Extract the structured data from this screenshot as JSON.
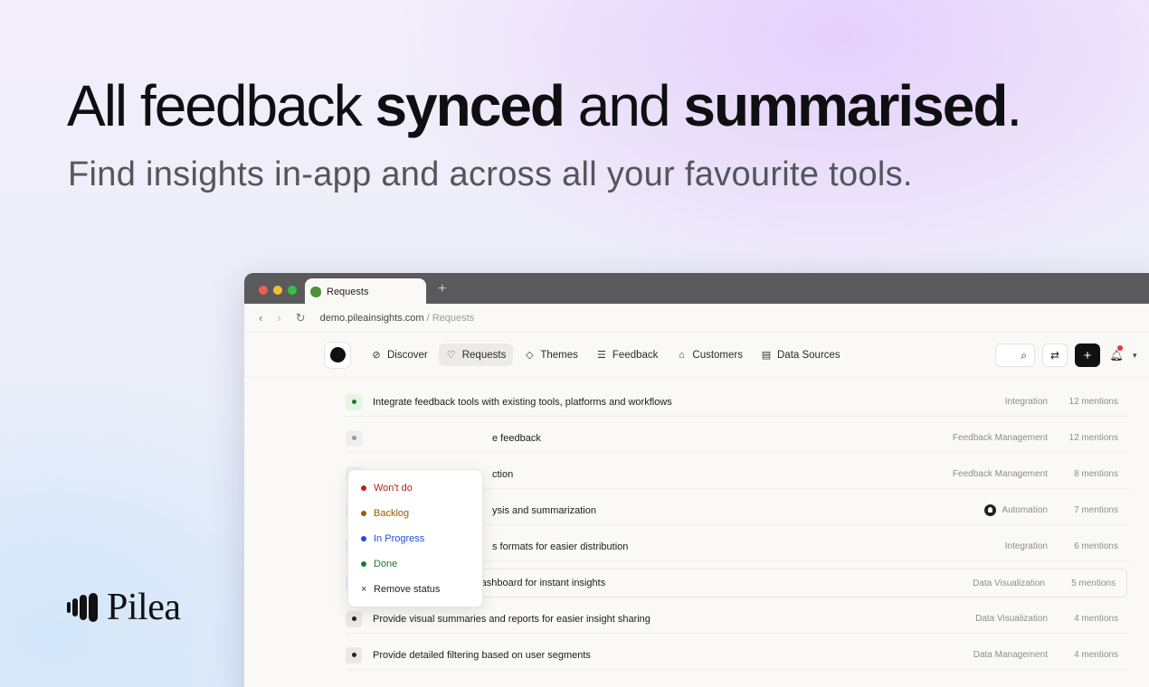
{
  "hero": {
    "title_1": "All  feedback ",
    "title_2": "synced",
    "title_3": " and ",
    "title_4": "summarised",
    "title_5": ".",
    "subtitle": "Find insights in-app and across all your favourite tools."
  },
  "brand": {
    "name": "Pilea"
  },
  "browser": {
    "tab_title": "Requests",
    "new_tab": "+",
    "url_domain": "demo.pileainsights.com",
    "url_path": " / Requests"
  },
  "nav": {
    "items": [
      {
        "label": "Discover",
        "icon": "compass-icon",
        "glyph": "⊘"
      },
      {
        "label": "Requests",
        "icon": "lightbulb-icon",
        "glyph": "♡"
      },
      {
        "label": "Themes",
        "icon": "tag-icon",
        "glyph": "◇"
      },
      {
        "label": "Feedback",
        "icon": "list-icon",
        "glyph": "☰"
      },
      {
        "label": "Customers",
        "icon": "building-icon",
        "glyph": "⌂"
      },
      {
        "label": "Data Sources",
        "icon": "database-icon",
        "glyph": "▤"
      }
    ],
    "active": "Requests"
  },
  "toolbar": {
    "search_glyph": "⌕",
    "sync_glyph": "⇄",
    "add_glyph": "+",
    "bell_glyph": "🔔︎",
    "chevron_glyph": "▾"
  },
  "status_menu": {
    "items": [
      {
        "label": "Won't do",
        "color": "#b42318"
      },
      {
        "label": "Backlog",
        "color": "#9a5b00"
      },
      {
        "label": "In Progress",
        "color": "#1d4ed8"
      },
      {
        "label": "Done",
        "color": "#1b7a35"
      },
      {
        "label": "Remove status",
        "color": "#222222"
      }
    ]
  },
  "requests": [
    {
      "title": "Integrate feedback tools with existing tools, platforms and workflows",
      "tag": "Integration",
      "mentions": "12 mentions",
      "status_color": "#1b7a35",
      "status_bg": "#e3f6e6"
    },
    {
      "title": "e feedback",
      "tag": "Feedback Management",
      "mentions": "12 mentions",
      "status_color": "#9a9a9a",
      "status_bg": "#eeeeee"
    },
    {
      "title": "ction",
      "tag": "Feedback Management",
      "mentions": "8 mentions",
      "status_color": "#9a9a9a",
      "status_bg": "#eeeeee"
    },
    {
      "title": "ysis and summarization",
      "tag": "Automation",
      "mentions": "7 mentions",
      "status_color": "#9a9a9a",
      "status_bg": "#eeeeee"
    },
    {
      "title": "s formats for easier distribution",
      "tag": "Integration",
      "mentions": "6 mentions",
      "status_color": "#9a9a9a",
      "status_bg": "#eeeeee"
    },
    {
      "title": "Create a live feedback dashboard for instant insights",
      "tag": "Data Visualization",
      "mentions": "5 mentions",
      "status_color": "#1d4ed8",
      "status_bg": "#e1ebfd"
    },
    {
      "title": "Provide visual summaries and reports for easier insight sharing",
      "tag": "Data Visualization",
      "mentions": "4 mentions",
      "status_color": "#222222",
      "status_bg": "#e9e9e7"
    },
    {
      "title": "Provide detailed filtering based on user segments",
      "tag": "Data Management",
      "mentions": "4 mentions",
      "status_color": "#222222",
      "status_bg": "#e9e9e7"
    }
  ]
}
